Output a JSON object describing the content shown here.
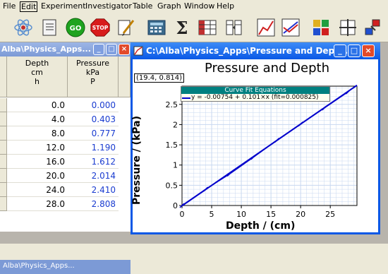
{
  "menu": [
    "File",
    "Edit",
    "Experiment",
    "Investigator",
    "Table",
    "Graph",
    "Window",
    "Help"
  ],
  "toolbar": {
    "go_label": "GO",
    "stop_label": "STOP",
    "icons": [
      "atom-icon",
      "notebook-icon",
      "go-icon",
      "stop-icon",
      "pencil-icon",
      "keypad-icon",
      "sigma-icon",
      "table-icon",
      "column-icon",
      "graph-icon",
      "graph2-icon",
      "data-icon",
      "crosshair-icon",
      "arrange-icon"
    ]
  },
  "table_window": {
    "title": "Alba\\Physics_Apps...",
    "columns": [
      {
        "name": "Depth",
        "unit": "cm",
        "symbol": "h"
      },
      {
        "name": "Pressure",
        "unit": "kPa",
        "symbol": "P"
      }
    ],
    "rows": [
      [
        "0.0",
        "0.000"
      ],
      [
        "4.0",
        "0.403"
      ],
      [
        "8.0",
        "0.777"
      ],
      [
        "12.0",
        "1.190"
      ],
      [
        "16.0",
        "1.612"
      ],
      [
        "20.0",
        "2.014"
      ],
      [
        "24.0",
        "2.410"
      ],
      [
        "28.0",
        "2.808"
      ]
    ],
    "minimized_title": "Alba\\Physics_Apps..."
  },
  "graph_window": {
    "title": "C:\\Alba\\Physics_Apps\\Pressure and Depth...",
    "coord_readout": "(19.4, 0.814)",
    "fit_header": "Curve Fit Equations",
    "fit_equation": "y = -0.00754 + 0.101×x (fit=0.000825)"
  },
  "chart_data": {
    "type": "scatter",
    "title": "Pressure and Depth",
    "xlabel": "Depth / (cm)",
    "ylabel": "Pressure / (kPa)",
    "x": [
      0,
      4,
      8,
      12,
      16,
      20,
      24,
      28
    ],
    "y": [
      0.0,
      0.403,
      0.777,
      1.19,
      1.612,
      2.014,
      2.41,
      2.808
    ],
    "fit": {
      "slope": 0.101,
      "intercept": -0.00754
    },
    "xlim": [
      0,
      29.5
    ],
    "ylim": [
      0,
      2.95
    ],
    "xticks": [
      "0",
      "5",
      "10",
      "15",
      "20",
      "25"
    ],
    "yticks": [
      "0",
      "0.5",
      "1",
      "1.5",
      "2",
      "2.5"
    ],
    "grid": true,
    "colors": {
      "line": "#0000cc",
      "grid": "#c8d8f0"
    }
  }
}
